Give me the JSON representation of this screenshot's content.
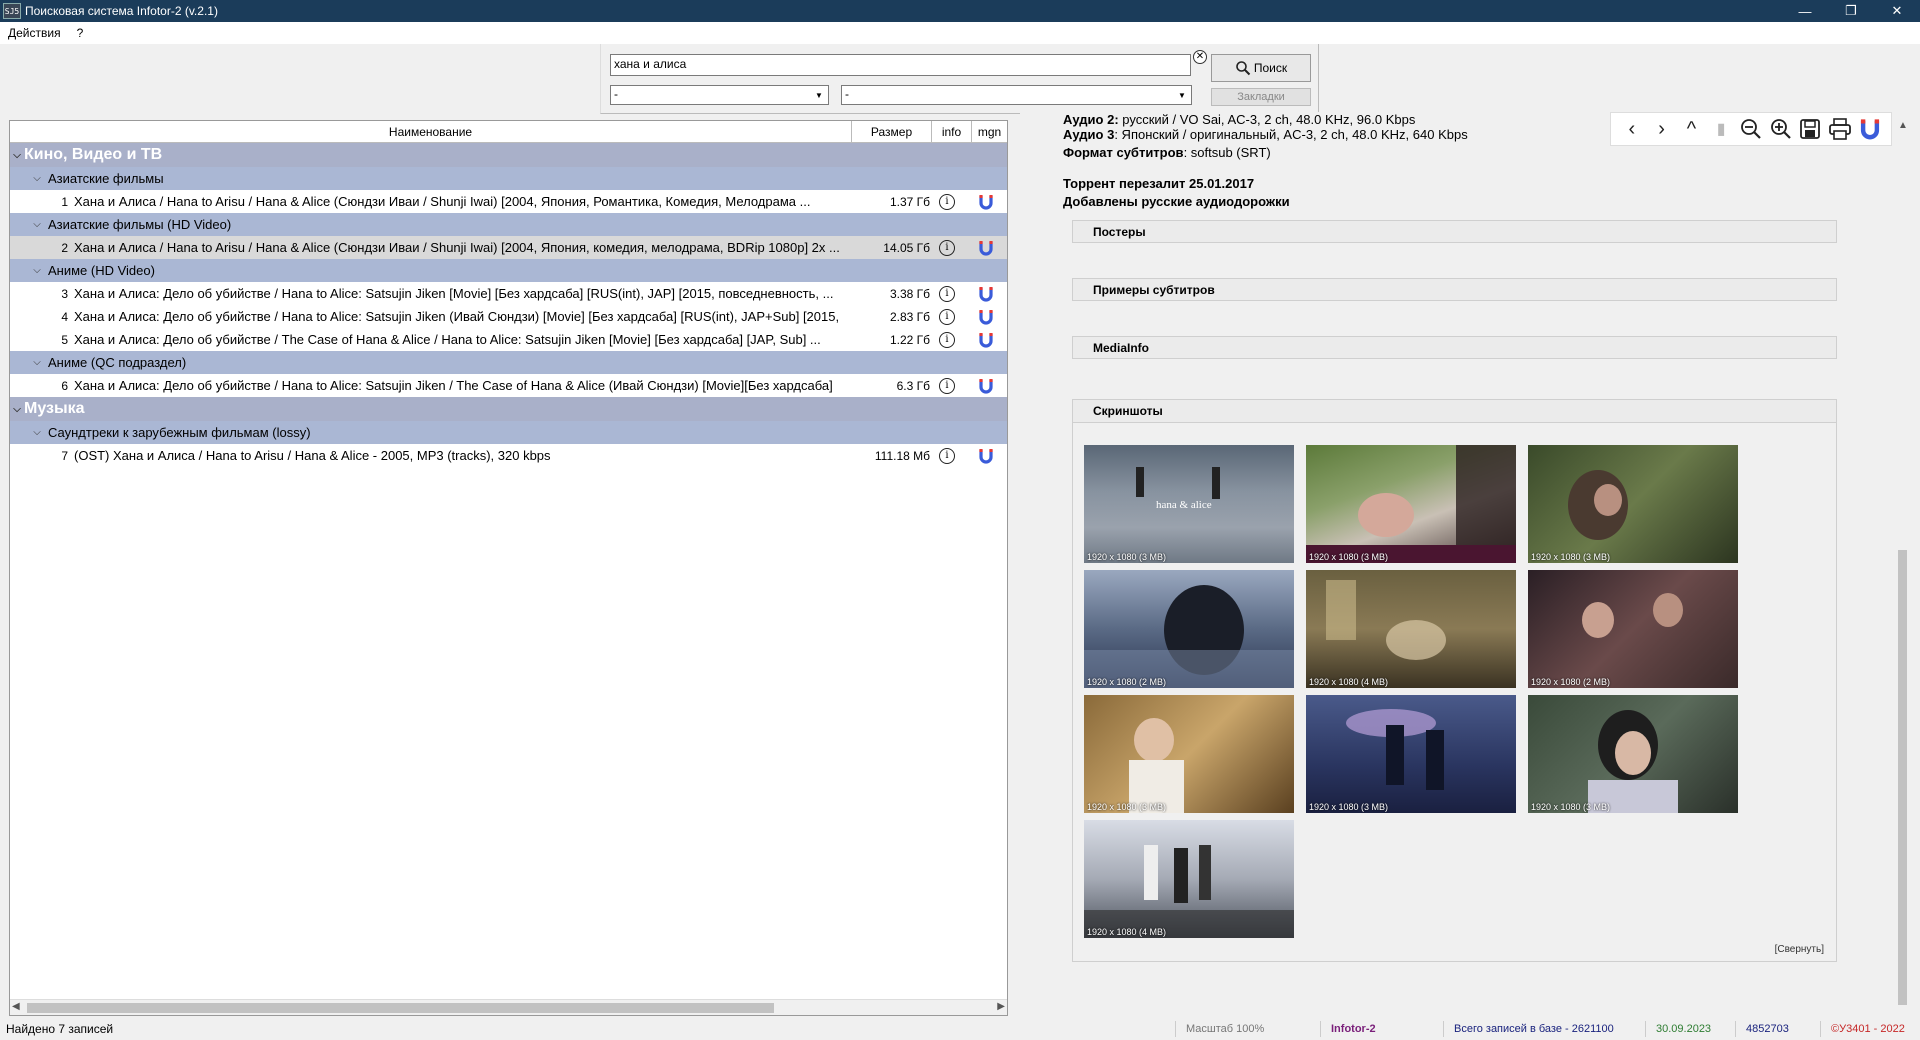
{
  "window": {
    "title": "Поисковая система Infotor-2 (v.2.1)",
    "icon_text": "SJ5",
    "controls": {
      "minimize": "—",
      "maximize": "❐",
      "close": "✕"
    }
  },
  "menu": [
    "Действия",
    "?"
  ],
  "search": {
    "query": "хана и алиса",
    "search_label": "Поиск",
    "bookmarks_label": "Закладки",
    "combo1": "-",
    "combo2": "-"
  },
  "table": {
    "columns": [
      "Наименование",
      "Размер",
      "info",
      "mgn"
    ],
    "groups": [
      {
        "name": "Кино, Видео и ТВ",
        "subgroups": [
          {
            "name": "Азиатские фильмы",
            "items": [
              {
                "num": "1",
                "title": "Хана и Алиса / Hana to Arisu / Hana & Alice (Сюндзи Иваи / Shunji Iwai) [2004, Япония, Романтика, Комедия, Мелодрама ...",
                "size": "1.37 Гб"
              }
            ]
          },
          {
            "name": "Азиатские фильмы (HD Video)",
            "items": [
              {
                "num": "2",
                "title": "Хана и Алиса / Hana to Arisu / Hana & Alice (Сюндзи Иваи / Shunji Iwai) [2004, Япония, комедия, мелодрама, BDRip 1080p] 2x ...",
                "size": "14.05 Гб",
                "selected": true
              }
            ]
          },
          {
            "name": "Аниме (HD Video)",
            "items": [
              {
                "num": "3",
                "title": "Хана и Алиса: Дело об убийстве / Hana to Alice: Satsujin Jiken [Movie] [Без хардсаба] [RUS(int), JAP] [2015, повседневность, ...",
                "size": "3.38 Гб"
              },
              {
                "num": "4",
                "title": "Хана и Алиса: Дело об убийстве / Hana to Alice: Satsujin Jiken (Ивай Сюндзи) [Movie] [Без хардсаба] [RUS(int), JAP+Sub] [2015,",
                "size": "2.83 Гб"
              },
              {
                "num": "5",
                "title": "Хана и Алиса: Дело об убийстве / The Case of Hana & Alice / Hana to Alice: Satsujin Jiken [Movie] [Без хардсаба] [JAP, Sub] ...",
                "size": "1.22 Гб"
              }
            ]
          },
          {
            "name": "Аниме (QC подраздел)",
            "items": [
              {
                "num": "6",
                "title": "Хана и Алиса: Дело об убийстве / Hana to Alice: Satsujin Jiken / The Case of Hana & Alice (Ивай Сюндзи) [Movie][Без хардсаба]",
                "size": "6.3 Гб"
              }
            ]
          }
        ]
      },
      {
        "name": "Музыка",
        "subgroups": [
          {
            "name": "Саундтреки к зарубежным фильмам (lossy)",
            "items": [
              {
                "num": "7",
                "title": "(OST) Хана и Алиса / Hana to Arisu / Hana & Alice - 2005, MP3 (tracks), 320 kbps",
                "size": "111.18 Мб"
              }
            ]
          }
        ]
      }
    ]
  },
  "details": {
    "audio2_label": "Аудио 2:",
    "audio2_value": " русский / VO Sai, AC-3, 2 ch, 48.0 KHz, 96.0 Kbps",
    "audio3_label": "Аудио 3",
    "audio3_value": ": Японский / оригинальный, AC-3, 2 ch, 48.0 KHz, 640 Kbps",
    "subs_label": "Формат субтитров",
    "subs_value": ": softsub (SRT)",
    "reupload": "Торрент перезалит 25.01.2017",
    "added": "Добавлены русские аудиодорожки",
    "sections": [
      "Постеры",
      "Примеры субтитров",
      "MediaInfo",
      "Скриншоты"
    ],
    "screenshots": [
      "1920 x 1080 (3 MB)",
      "1920 x 1080 (3 MB)",
      "1920 x 1080 (3 MB)",
      "1920 x 1080 (2 MB)",
      "1920 x 1080 (4 MB)",
      "1920 x 1080 (2 MB)",
      "1920 x 1080 (3 MB)",
      "1920 x 1080 (3 MB)",
      "1920 x 1080 (3 MB)",
      "1920 x 1080 (4 MB)"
    ],
    "screenshot_overlay_text": "hana & alice",
    "collapse_label": "[Свернуть]"
  },
  "toolbar_icons": [
    "back-icon",
    "forward-icon",
    "up-icon",
    "bookmark-icon",
    "zoom-out-icon",
    "zoom-in-icon",
    "save-icon",
    "print-icon",
    "magnet-icon"
  ],
  "status": {
    "found": "Найдено 7 записей",
    "scale": "Масштаб 100%",
    "app": "Infotor-2",
    "total": "Всего записей в базе - 2621100",
    "date": "30.09.2023",
    "count": "4852703",
    "copyright": "©У3401 - 2022"
  },
  "colors": {
    "titlebar": "#1b3c5a",
    "category_row": "#a9b0c9",
    "subcategory_row": "#aab7d4",
    "selected_row": "#d9d9d9",
    "app_name": "#7a1f7a",
    "date": "#2e7d32",
    "total": "#1a237e",
    "copyright": "#c62828",
    "magnet_blue": "#3a5bd9",
    "magnet_red": "#e53935"
  }
}
